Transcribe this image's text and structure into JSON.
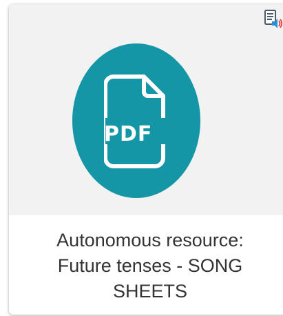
{
  "card": {
    "title_lines": [
      "Autonomous resource:",
      "Future tenses - SONG",
      "SHEETS"
    ],
    "file_type_label": "PDF",
    "file_icon": "pdf-file-icon",
    "accent_color": "#1496a6",
    "thumbnail_bg": "#f2f2f2"
  },
  "toolbar": {
    "read_aloud_icon": "read-aloud-speaker-icon"
  }
}
